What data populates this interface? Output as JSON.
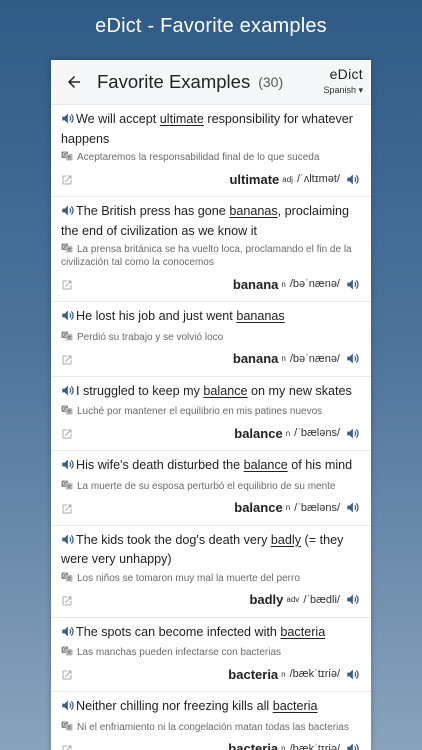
{
  "banner": "eDict - Favorite examples",
  "header": {
    "title": "Favorite Examples",
    "count": "(30)",
    "brand": "eDict",
    "language": "Spanish ▾"
  },
  "items": [
    {
      "pre": "We will accept ",
      "hl": "ultimate",
      "post": " responsibility for whatever happens",
      "es": "Aceptaremos la responsabilidad final de lo que suceda",
      "word": "ultimate",
      "pos": "adj",
      "pron": "/ˈʌltɪmət/"
    },
    {
      "pre": "The British press has gone ",
      "hl": "bananas",
      "post": ", proclaiming the end of civilization as we know it",
      "es": "La prensa británica se ha vuelto loca, proclamando el fin de la civilización tal como la conocemos",
      "word": "banana",
      "pos": "n",
      "pron": "/bəˈnænə/"
    },
    {
      "pre": "He lost his job and just went ",
      "hl": "bananas",
      "post": "",
      "es": "Perdió su trabajo y se volvió loco",
      "word": "banana",
      "pos": "n",
      "pron": "/bəˈnænə/"
    },
    {
      "pre": "I struggled to keep my ",
      "hl": "balance",
      "post": " on my new skates",
      "es": "Luché por mantener el equilibrio en mis patines nuevos",
      "word": "balance",
      "pos": "n",
      "pron": "/ˈbæləns/"
    },
    {
      "pre": "His wife's death disturbed the ",
      "hl": "balance",
      "post": " of his mind",
      "es": "La muerte de su esposa perturbó el equilibrio de su mente",
      "word": "balance",
      "pos": "n",
      "pron": "/ˈbæləns/"
    },
    {
      "pre": "The kids took the dog's death very ",
      "hl": "badly",
      "post": " (= they were very unhappy)",
      "es": "Los niños se tomaron muy mal la muerte del perro",
      "word": "badly",
      "pos": "adv",
      "pron": "/ˈbædli/"
    },
    {
      "pre": "The spots can become infected with ",
      "hl": "bacteria",
      "post": "",
      "es": "Las manchas pueden infectarse con bacterias",
      "word": "bacteria",
      "pos": "n",
      "pron": "/bækˈtɪriə/"
    },
    {
      "pre": "Neither chilling nor freezing kills all ",
      "hl": "bacteria",
      "post": "",
      "es": "Ni el enfriamiento ni la congelación matan todas las bacterias",
      "word": "bacteria",
      "pos": "n",
      "pron": "/bækˈtɪriə/"
    }
  ]
}
